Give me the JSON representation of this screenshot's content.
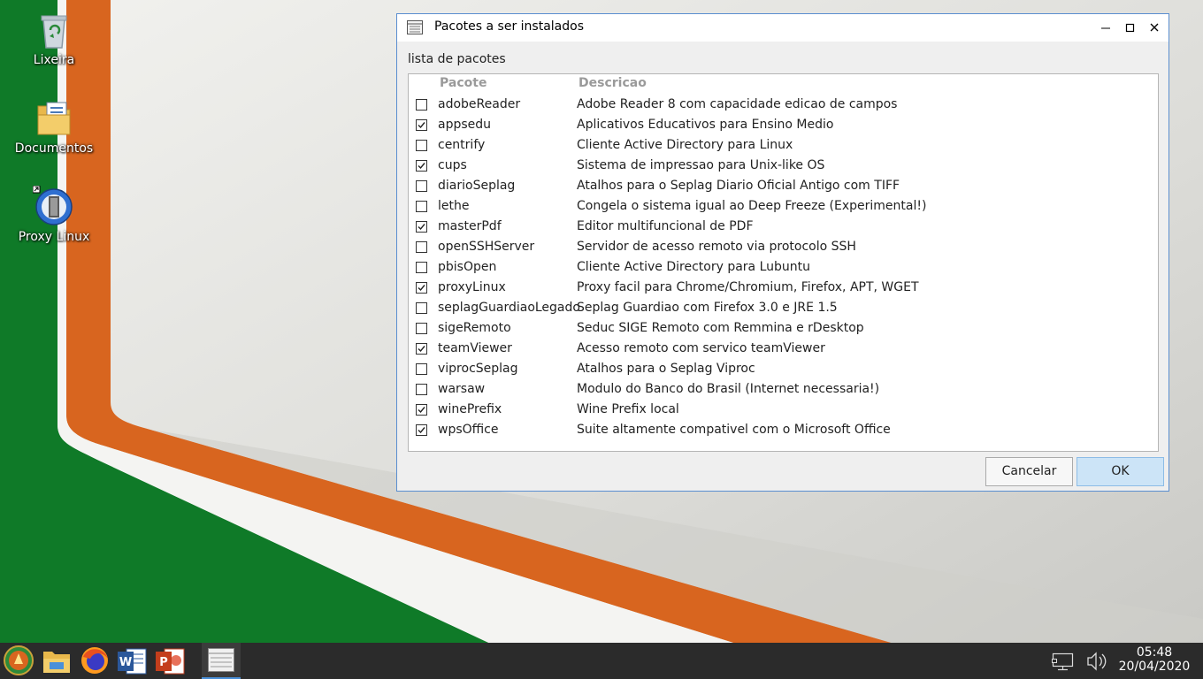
{
  "desktop": {
    "icons": [
      {
        "label": "Lixeira",
        "icon": "trash-icon"
      },
      {
        "label": "Documentos",
        "icon": "folder-documents-icon"
      },
      {
        "label": "Proxy Linux",
        "icon": "globe-proxy-icon"
      }
    ]
  },
  "dialog": {
    "title": "Pacotes a ser instalados",
    "list_label": "lista de pacotes",
    "columns": {
      "package": "Pacote",
      "description": "Descricao"
    },
    "packages": [
      {
        "name": "adobeReader",
        "description": "Adobe Reader 8 com capacidade edicao de campos",
        "checked": false
      },
      {
        "name": "appsedu",
        "description": "Aplicativos Educativos para Ensino Medio",
        "checked": true
      },
      {
        "name": "centrify",
        "description": "Cliente Active Directory para Linux",
        "checked": false
      },
      {
        "name": "cups",
        "description": "Sistema de impressao para Unix-like OS",
        "checked": true
      },
      {
        "name": "diarioSeplag",
        "description": "Atalhos para o Seplag Diario Oficial Antigo com TIFF",
        "checked": false
      },
      {
        "name": "lethe",
        "description": "Congela o sistema igual ao Deep Freeze (Experimental!)",
        "checked": false
      },
      {
        "name": "masterPdf",
        "description": "Editor multifuncional de PDF",
        "checked": true
      },
      {
        "name": "openSSHServer",
        "description": "Servidor de acesso remoto via protocolo SSH",
        "checked": false
      },
      {
        "name": "pbisOpen",
        "description": "Cliente Active Directory para Lubuntu",
        "checked": false
      },
      {
        "name": "proxyLinux",
        "description": "Proxy facil para Chrome/Chromium, Firefox, APT, WGET",
        "checked": true
      },
      {
        "name": "seplagGuardiaoLegado",
        "description": "Seplag Guardiao com Firefox 3.0 e JRE 1.5",
        "checked": false
      },
      {
        "name": "sigeRemoto",
        "description": "Seduc SIGE Remoto com Remmina e rDesktop",
        "checked": false
      },
      {
        "name": "teamViewer",
        "description": "Acesso remoto com servico teamViewer",
        "checked": true
      },
      {
        "name": "viprocSeplag",
        "description": "Atalhos para o Seplag Viproc",
        "checked": false
      },
      {
        "name": "warsaw",
        "description": "Modulo do Banco do Brasil (Internet necessaria!)",
        "checked": false
      },
      {
        "name": "winePrefix",
        "description": "Wine Prefix local",
        "checked": true
      },
      {
        "name": "wpsOffice",
        "description": "Suite altamente compativel com o Microsoft Office",
        "checked": true
      }
    ],
    "buttons": {
      "cancel": "Cancelar",
      "ok": "OK"
    }
  },
  "taskbar": {
    "items": [
      "start-menu-icon",
      "file-manager-icon",
      "firefox-icon",
      "word-icon",
      "powerpoint-icon",
      "package-list-window-icon"
    ],
    "clock": {
      "time": "05:48",
      "date": "20/04/2020"
    },
    "tray": [
      "network-icon",
      "volume-icon"
    ]
  },
  "colors": {
    "wallpaper_green": "#0f7a28",
    "wallpaper_orange": "#d8651f",
    "dialog_border": "#5a8ed0",
    "ok_button": "#cce4f7"
  }
}
